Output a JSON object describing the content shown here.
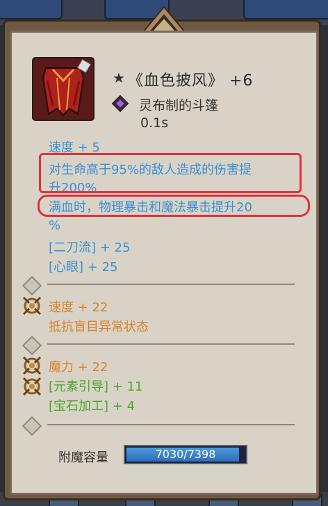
{
  "item": {
    "star": "★",
    "name": "《血色披风》 +6",
    "material": "灵布制的斗篷",
    "speed": "0.1s"
  },
  "base_stats": {
    "line1": "速度 + 5",
    "line2a": "对生命高于95%的敌人造成的伤害提",
    "line2b": "升200%",
    "line3a": "满血时，物理暴击和魔法暴击提升20",
    "line3b": "%",
    "line4": "[二刀流] + 25",
    "line5": "[心眼] + 25"
  },
  "enchant_1": {
    "line1": "速度 + 22",
    "line2": "抵抗盲目异常状态"
  },
  "enchant_2": {
    "line1": "魔力 + 22",
    "line2": "[元素引导] + 11",
    "line3": "[宝石加工] + 4"
  },
  "capacity": {
    "label": "附魔容量",
    "text": "7030/7398",
    "current": 7030,
    "max": 7398
  },
  "colors": {
    "stat_blue": "#3a8fd6",
    "enchant_orange": "#d9822b",
    "enchant_green": "#4fa52f",
    "highlight_red": "#e0303a"
  }
}
